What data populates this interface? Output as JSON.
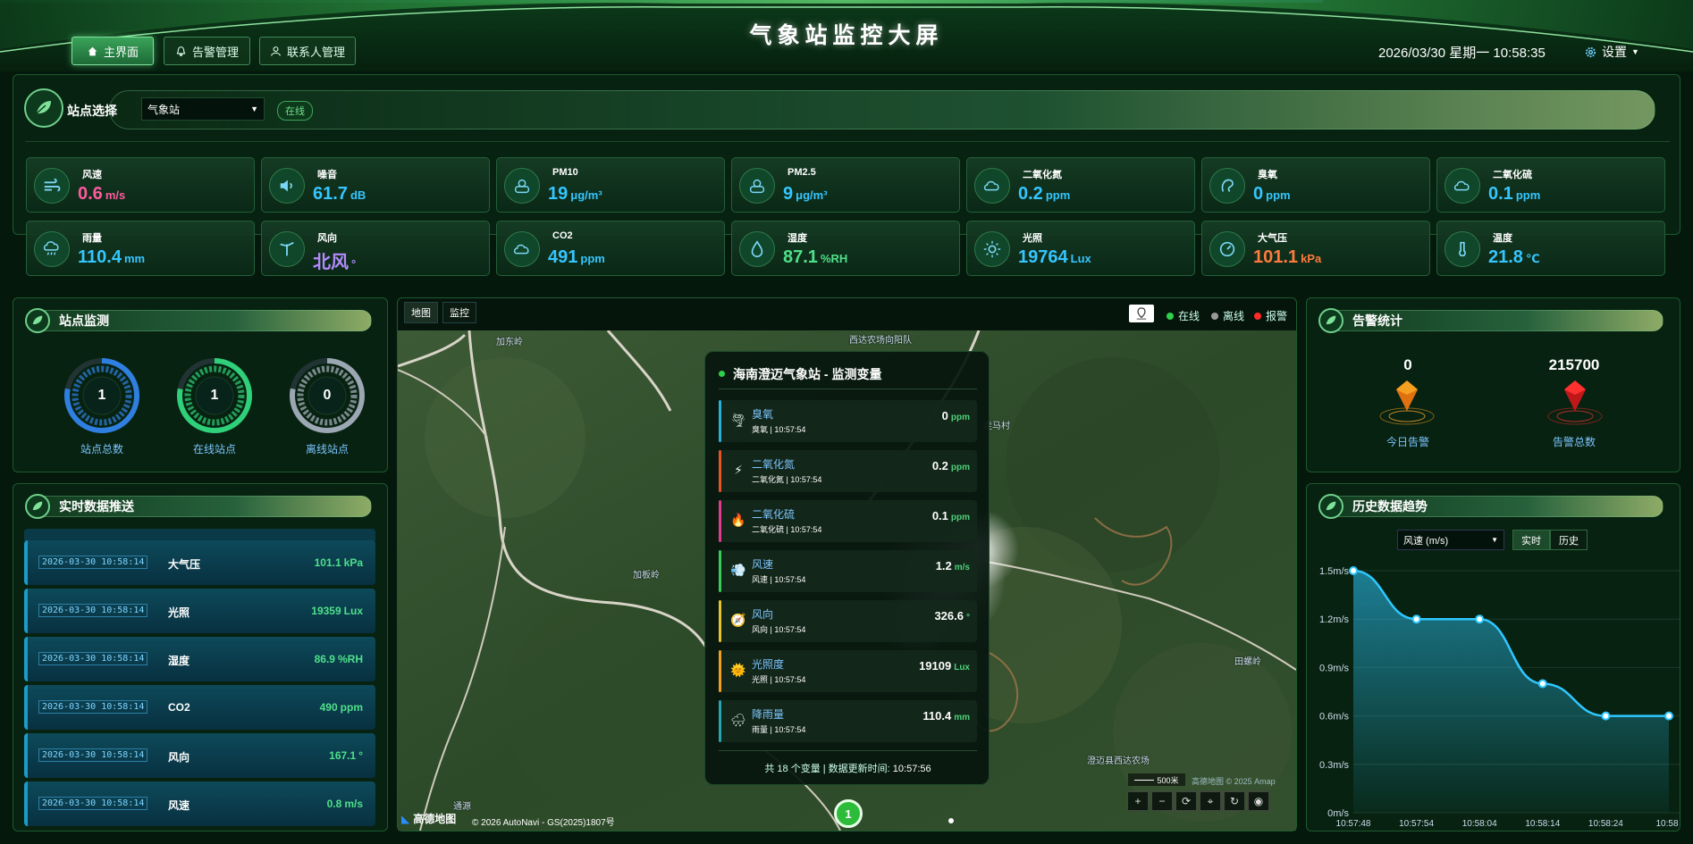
{
  "header": {
    "title": "气象站监控大屏",
    "datetime": "2026/03/30 星期一 10:58:35",
    "settings": "设置",
    "nav": [
      {
        "label": "主界面"
      },
      {
        "label": "告警管理"
      },
      {
        "label": "联系人管理"
      }
    ]
  },
  "station": {
    "label": "站点选择",
    "selected": "气象站",
    "status": "在线"
  },
  "sensors": [
    {
      "name": "风速",
      "value": "0.6",
      "unit": "m/s",
      "color": "#ff5aa0",
      "icon": "wind-icon"
    },
    {
      "name": "噪音",
      "value": "61.7",
      "unit": "dB",
      "color": "#35c6ff",
      "icon": "speaker-icon"
    },
    {
      "name": "PM10",
      "value": "19",
      "unit": "μg/m³",
      "color": "#35c6ff",
      "icon": "pm10-icon"
    },
    {
      "name": "PM2.5",
      "value": "9",
      "unit": "μg/m³",
      "color": "#35c6ff",
      "icon": "pm25-icon"
    },
    {
      "name": "二氧化氮",
      "value": "0.2",
      "unit": "ppm",
      "color": "#35c6ff",
      "icon": "no2-icon"
    },
    {
      "name": "臭氧",
      "value": "0",
      "unit": "ppm",
      "color": "#35c6ff",
      "icon": "ozone-icon"
    },
    {
      "name": "二氧化硫",
      "value": "0.1",
      "unit": "ppm",
      "color": "#35c6ff",
      "icon": "so2-icon"
    },
    {
      "name": "雨量",
      "value": "110.4",
      "unit": "mm",
      "color": "#35c6ff",
      "icon": "rain-icon"
    },
    {
      "name": "风向",
      "value": "北风",
      "unit": "°",
      "color": "#b58bff",
      "icon": "wind-direction-icon"
    },
    {
      "name": "CO2",
      "value": "491",
      "unit": "ppm",
      "color": "#35c6ff",
      "icon": "co2-icon"
    },
    {
      "name": "湿度",
      "value": "87.1",
      "unit": "%RH",
      "color": "#4fe08a",
      "icon": "humidity-icon"
    },
    {
      "name": "光照",
      "value": "19764",
      "unit": "Lux",
      "color": "#35c6ff",
      "icon": "sun-icon"
    },
    {
      "name": "大气压",
      "value": "101.1",
      "unit": "kPa",
      "color": "#ff7a3c",
      "icon": "pressure-icon"
    },
    {
      "name": "温度",
      "value": "21.8",
      "unit": "℃",
      "color": "#35c6ff",
      "icon": "thermometer-icon"
    }
  ],
  "monitor": {
    "title": "站点监测",
    "rings": [
      {
        "value": "1",
        "label": "站点总数",
        "color": "#2f7fe0",
        "fill": 1
      },
      {
        "value": "1",
        "label": "在线站点",
        "color": "#2fd07a",
        "fill": 1
      },
      {
        "value": "0",
        "label": "离线站点",
        "color": "#a8b4c0",
        "fill": 0
      }
    ]
  },
  "realtime": {
    "title": "实时数据推送",
    "rows": [
      {
        "time": "2026-03-30 10:58:14",
        "name": "大气压",
        "value": "101.1",
        "unit": "kPa"
      },
      {
        "time": "2026-03-30 10:58:14",
        "name": "光照",
        "value": "19359",
        "unit": "Lux"
      },
      {
        "time": "2026-03-30 10:58:14",
        "name": "湿度",
        "value": "86.9",
        "unit": "%RH"
      },
      {
        "time": "2026-03-30 10:58:14",
        "name": "CO2",
        "value": "490",
        "unit": "ppm"
      },
      {
        "time": "2026-03-30 10:58:14",
        "name": "风向",
        "value": "167.1",
        "unit": "°"
      },
      {
        "time": "2026-03-30 10:58:14",
        "name": "风速",
        "value": "0.8",
        "unit": "m/s"
      }
    ]
  },
  "map": {
    "tabs": [
      "地图",
      "监控"
    ],
    "legend": [
      "在线",
      "离线",
      "报警"
    ],
    "places": [
      "加东岭",
      "西达农场向阳队",
      "走马村",
      "加板岭",
      "田螺岭",
      "澄迈县西达农场",
      "通源"
    ],
    "scale": "500米",
    "copyright": "© 2026 AutoNavi - GS(2025)1807号",
    "logo": "高德地图",
    "amap": "高德地图 © 2025 Amap",
    "marker": "1",
    "popup": {
      "title": "海南澄迈气象站 - 监测变量",
      "footer_prefix": "共 18 个变量 | 数据更新时间: ",
      "footer_time": "10:57:56",
      "vars": [
        {
          "name": "臭氧",
          "sub": "臭氧 | 10:57:54",
          "value": "0",
          "unit": "ppm",
          "color": "#2ab0d6",
          "icon": "🌪"
        },
        {
          "name": "二氧化氮",
          "sub": "二氧化氮 | 10:57:54",
          "value": "0.2",
          "unit": "ppm",
          "color": "#e8542a",
          "icon": "⚡"
        },
        {
          "name": "二氧化硫",
          "sub": "二氧化硫 | 10:57:54",
          "value": "0.1",
          "unit": "ppm",
          "color": "#e23a8c",
          "icon": "🔥"
        },
        {
          "name": "风速",
          "sub": "风速 | 10:57:54",
          "value": "1.2",
          "unit": "m/s",
          "color": "#3acb5a",
          "icon": "💨"
        },
        {
          "name": "风向",
          "sub": "风向 | 10:57:54",
          "value": "326.6",
          "unit": "°",
          "color": "#e8c42a",
          "icon": "🧭"
        },
        {
          "name": "光照度",
          "sub": "光照 | 10:57:54",
          "value": "19109",
          "unit": "Lux",
          "color": "#f0a020",
          "icon": "🌞"
        },
        {
          "name": "降雨量",
          "sub": "雨量 | 10:57:54",
          "value": "110.4",
          "unit": "mm",
          "color": "#2aa4b0",
          "icon": "🌧"
        }
      ]
    }
  },
  "alarm": {
    "title": "告警统计",
    "today_value": "0",
    "today_label": "今日告警",
    "total_value": "215700",
    "total_label": "告警总数"
  },
  "history": {
    "title": "历史数据趋势",
    "select": "风速 (m/s)",
    "tabs": [
      "实时",
      "历史"
    ]
  },
  "chart_data": {
    "type": "line",
    "x": [
      "10:57:48",
      "10:57:54",
      "10:58:04",
      "10:58:14",
      "10:58:24",
      "10:58"
    ],
    "series": [
      {
        "values": [
          1.5,
          1.2,
          1.2,
          0.8,
          0.6,
          0.6
        ]
      }
    ],
    "yticks": [
      "0m/s",
      "0.3m/s",
      "0.6m/s",
      "0.9m/s",
      "1.2m/s",
      "1.5m/s"
    ],
    "ylim": [
      0,
      1.5
    ],
    "color": "#2ec8ff"
  }
}
